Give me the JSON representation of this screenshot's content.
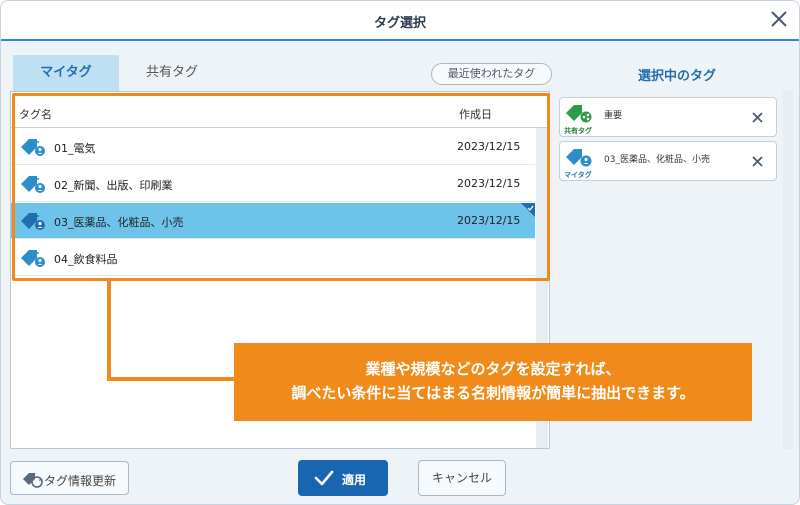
{
  "dialog": {
    "title": "タグ選択"
  },
  "tabs": {
    "mytag": "マイタグ",
    "shared": "共有タグ"
  },
  "recent_button": "最近使われたタグ",
  "list": {
    "columns": {
      "name": "タグ名",
      "date": "作成日"
    },
    "rows": [
      {
        "name": "01_電気",
        "date": "2023/12/15",
        "selected": false
      },
      {
        "name": "02_新聞、出版、印刷業",
        "date": "2023/12/15",
        "selected": false
      },
      {
        "name": "03_医薬品、化粧品、小売",
        "date": "2023/12/15",
        "selected": true
      },
      {
        "name": "04_飲食料品",
        "date": "",
        "selected": false
      }
    ]
  },
  "callout": {
    "line1": "業種や規模などのタグを設定すれば、",
    "line2": "調べたい条件に当てはまる名刺情報が簡単に抽出できます。"
  },
  "selected_panel": {
    "title": "選択中のタグ",
    "chips": [
      {
        "name": "重要",
        "source": "共有タグ",
        "icon": "shared-tag-icon"
      },
      {
        "name": "03_医薬品、化粧品、小売",
        "source": "マイタグ",
        "icon": "my-tag-icon"
      }
    ]
  },
  "footer": {
    "refresh_label": "タグ情報更新",
    "apply_label": "適用",
    "cancel_label": "キャンセル"
  },
  "colors": {
    "accent": "#1866b0",
    "highlight": "#f08a1b",
    "selected_row": "#6ec3ea",
    "tab_active": "#bfe0f2"
  }
}
